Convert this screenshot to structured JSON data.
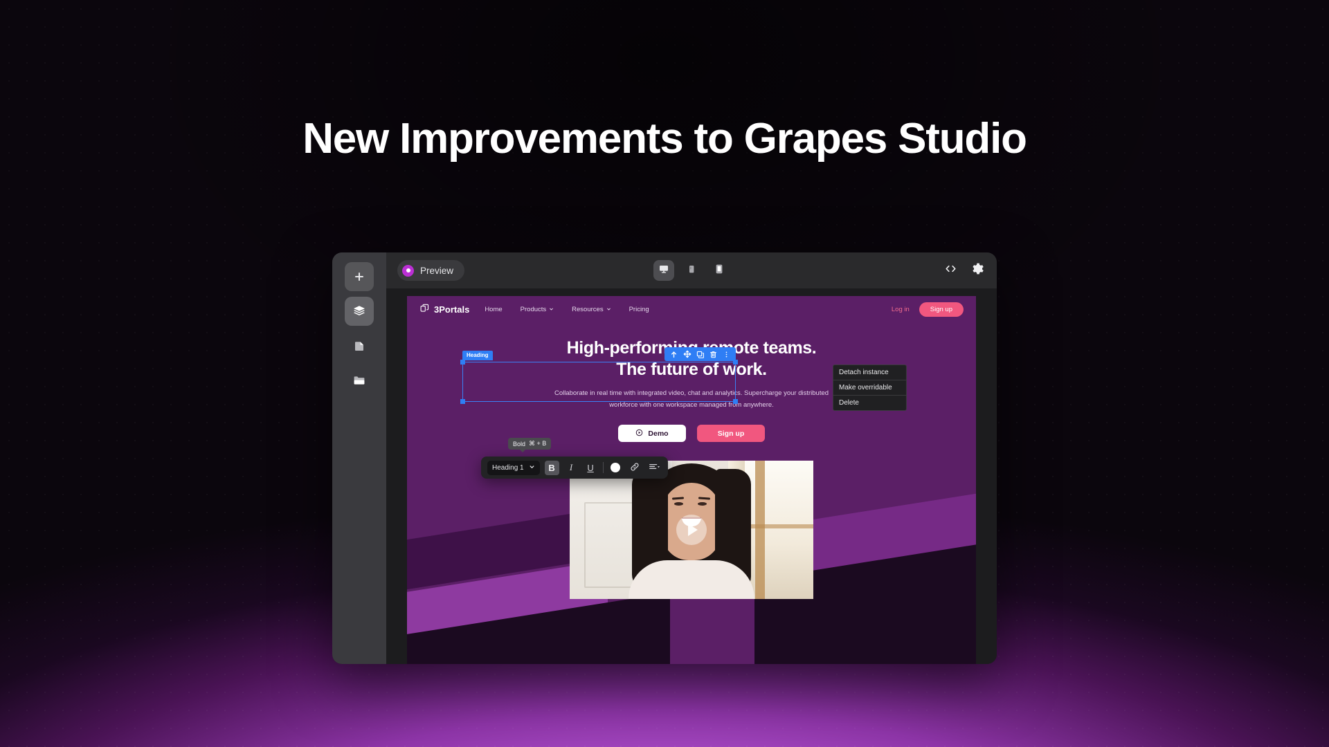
{
  "page": {
    "headline": "New Improvements to Grapes Studio",
    "background_top_color": "#09070c",
    "background_glow_color": "#b758d6"
  },
  "editor": {
    "rail": {
      "items": [
        {
          "name": "add",
          "icon": "plus-icon",
          "active": false
        },
        {
          "name": "layers",
          "icon": "layers-icon",
          "active": true
        },
        {
          "name": "pages",
          "icon": "page-icon",
          "active": false
        },
        {
          "name": "assets",
          "icon": "folder-icon",
          "active": false
        }
      ]
    },
    "topbar": {
      "preview_label": "Preview",
      "devices": [
        {
          "name": "desktop",
          "icon": "desktop-icon",
          "active": true
        },
        {
          "name": "mobile",
          "icon": "mobile-icon",
          "active": false
        },
        {
          "name": "tablet",
          "icon": "tablet-icon",
          "active": false
        }
      ],
      "actions": [
        {
          "name": "code",
          "icon": "code-icon"
        },
        {
          "name": "settings",
          "icon": "gear-icon"
        }
      ]
    }
  },
  "site": {
    "brand": "3Portals",
    "nav": [
      {
        "label": "Home",
        "caret": false
      },
      {
        "label": "Products",
        "caret": true
      },
      {
        "label": "Resources",
        "caret": true
      },
      {
        "label": "Pricing",
        "caret": false
      }
    ],
    "login_label": "Log in",
    "signup_label": "Sign up",
    "hero": {
      "heading_line1": "High-performing remote teams.",
      "heading_line2": "The future of work.",
      "paragraph": "Collaborate in real time with integrated video, chat and analytics. Supercharge your distributed workforce with one workspace managed from anywhere.",
      "cta_primary": "Demo",
      "cta_secondary": "Sign up"
    },
    "accent_pink": "#f1577f",
    "bg_purple": "#5b1f66"
  },
  "selection": {
    "tag": "Heading",
    "accent": "#2f7ef5",
    "toolbar_icons": [
      "arrow-up-icon",
      "move-icon",
      "copy-icon",
      "trash-icon",
      "kebab-menu-icon"
    ]
  },
  "context_menu": {
    "items": [
      {
        "label": "Detach instance"
      },
      {
        "label": "Make overridable"
      },
      {
        "label": "Delete"
      }
    ]
  },
  "rte_toolbar": {
    "block_type": "Heading 1",
    "buttons": [
      {
        "name": "bold",
        "glyph": "B",
        "active": true
      },
      {
        "name": "italic",
        "glyph": "I",
        "active": false
      },
      {
        "name": "underline",
        "glyph": "U",
        "active": false
      }
    ],
    "color_value": "#ffffff",
    "link_icon": "link-icon",
    "align_icon": "align-left-icon"
  },
  "tooltip": {
    "label": "Bold",
    "shortcut": "⌘ + B"
  }
}
